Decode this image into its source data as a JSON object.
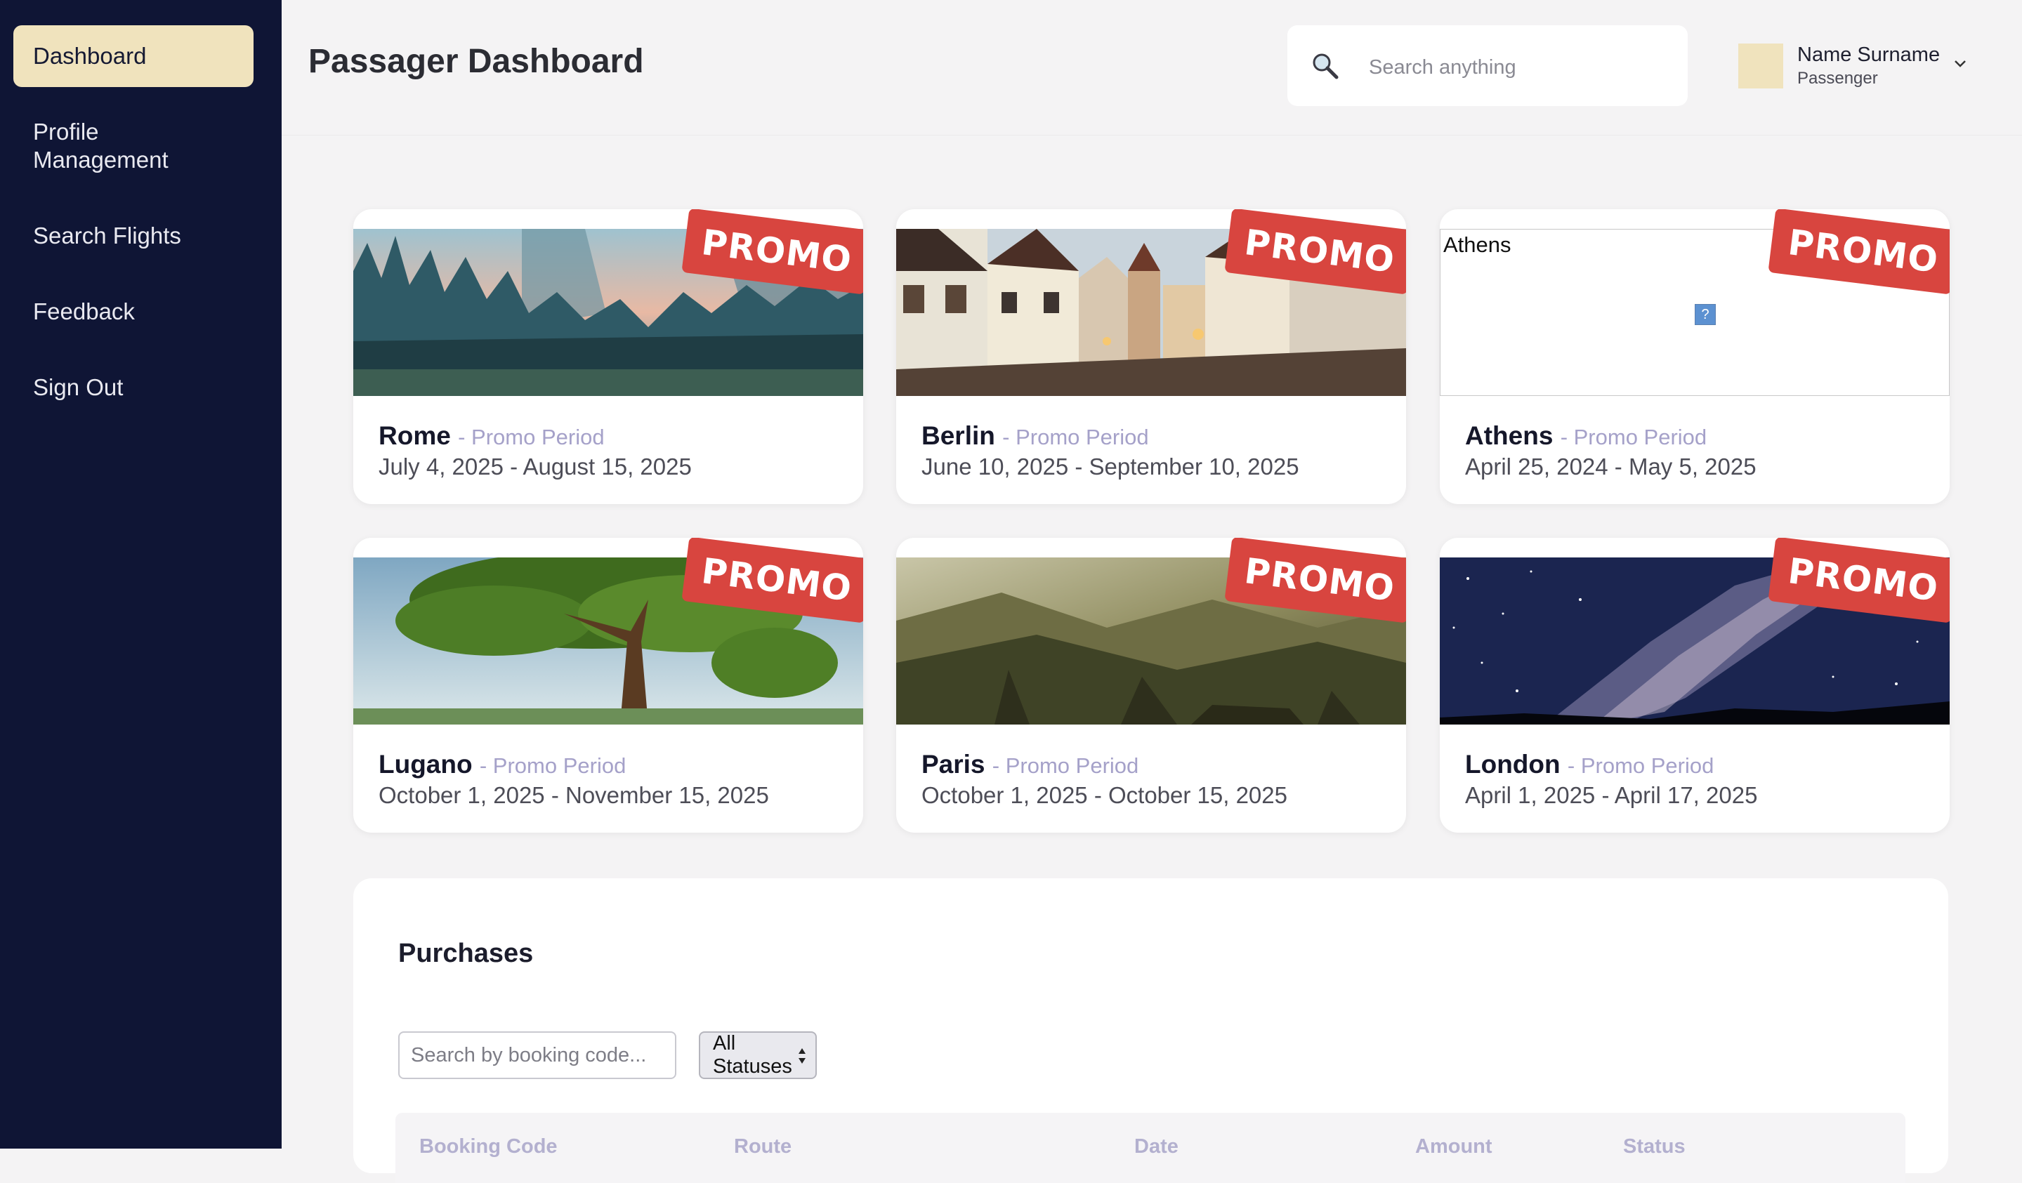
{
  "sidebar": {
    "items": [
      {
        "label": "Dashboard",
        "active": true
      },
      {
        "label": "Profile\nManagement"
      },
      {
        "label": "Search Flights"
      },
      {
        "label": "Feedback"
      },
      {
        "label": "Sign Out"
      }
    ]
  },
  "header": {
    "title": "Passager Dashboard",
    "search_placeholder": "Search anything",
    "user_name": "Name Surname",
    "user_role": "Passenger"
  },
  "promo_label": "PROMO",
  "period_label": "- Promo Period",
  "destinations": [
    {
      "city": "Rome",
      "dates": "July 4, 2025 - August 15, 2025",
      "image": "misty-forest"
    },
    {
      "city": "Berlin",
      "dates": "June 10, 2025 - September 10, 2025",
      "image": "old-town-houses"
    },
    {
      "city": "Athens",
      "dates": "April 25, 2024 - May 5, 2025",
      "image": "broken",
      "image_alt": "Athens"
    },
    {
      "city": "Lugano",
      "dates": "October 1, 2025 - November 15, 2025",
      "image": "tree"
    },
    {
      "city": "Paris",
      "dates": "October 1, 2025 - October 15, 2025",
      "image": "mountain-valley"
    },
    {
      "city": "London",
      "dates": "April 1, 2025 - April 17, 2025",
      "image": "milky-way"
    }
  ],
  "purchases": {
    "title": "Purchases",
    "search_placeholder": "Search by booking code...",
    "status_filter": "All Statuses",
    "columns": [
      "Booking Code",
      "Route",
      "Date",
      "Amount",
      "Status"
    ]
  },
  "colors": {
    "sidebar_bg": "#0f1535",
    "active_nav": "#f0e3bd",
    "promo": "#d8453f",
    "period_text": "#a5a1c9"
  }
}
